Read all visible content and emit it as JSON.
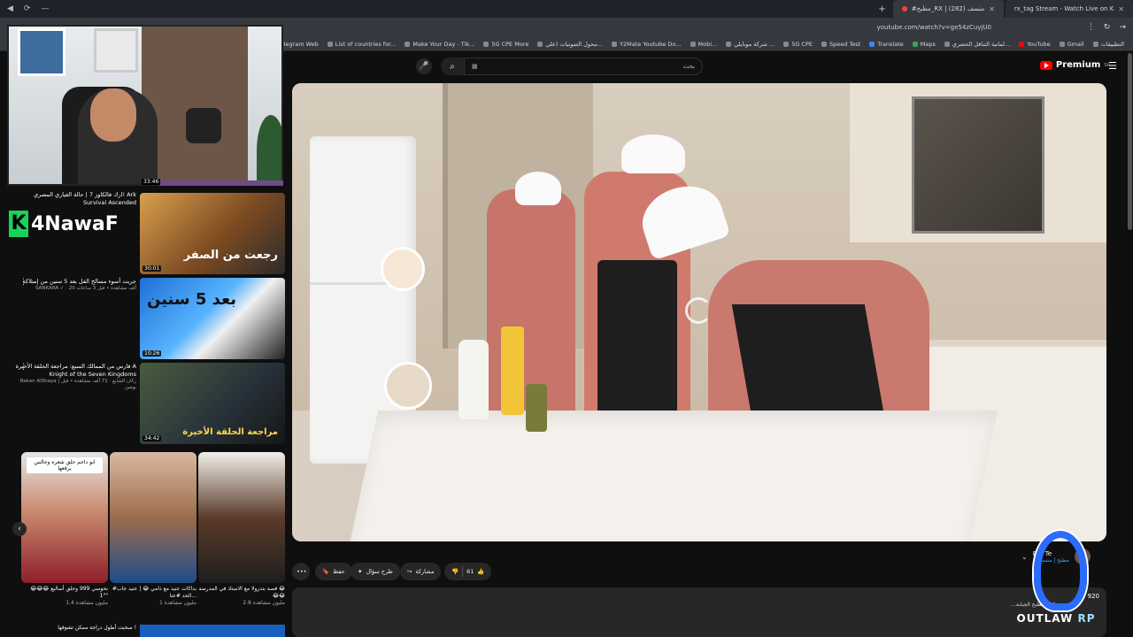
{
  "window_controls": [
    "◀",
    "⟳",
    "—"
  ],
  "tabs": [
    {
      "label": "rx_tag Stream - Watch Live on K",
      "active": false
    },
    {
      "label": "#مطبخ_RX | منسف (282)",
      "active": true
    }
  ],
  "url": "youtube.com/watch?v=ge54zCuyjU0",
  "bookmarks": [
    "التطبيقات",
    "Gmail",
    "YouTube",
    "لمانية التناقل الحضري...",
    "Maps",
    "Translate",
    "Speed Test",
    "5G CPE",
    "شركة موبايلي ...",
    "Mobi...",
    "Y2Mate Youtube Do...",
    "محول الصوتيات (علي...",
    "5G CPE More",
    "Make Your Day - Tik...",
    "List of countries for...",
    "Telegram Web",
    "ouTube"
  ],
  "header": {
    "search_placeholder": "بحث",
    "search_value": "▦",
    "logo_text": "Premium",
    "logo_region": "SA"
  },
  "webcam": {
    "timer": "33:46"
  },
  "brand": {
    "k": "K",
    "name": "4NawaF"
  },
  "recommendations": [
    {
      "title": "ارك فالكاوز 7 | حالة الغياري المصري! Ark Survival Ascended",
      "meta": "",
      "duration": "30:01",
      "thumb_caption": "رجعت من الصفر"
    },
    {
      "title": "جربت أسوء مسالخ الفل بعد 5 سنين من إمتلاكه",
      "meta": "SANKARA ✓ · 20 ألف مشاهدة • قبل 3 ساعات",
      "duration": "10:26",
      "thumb_caption": "بعد 5 سنين"
    },
    {
      "title": "فارس من الممالك السبع: مراجعة الحلقة الأخيرة A Knight of the Seven Kingdoms",
      "meta": "Rakan AlShaya | ركان الشايع · 71 ألف مشاهدة • قبل يومين",
      "duration": "34:42",
      "thumb_caption": "مراجعة الحلقة الأخيرة"
    }
  ],
  "shorts": [
    {
      "caption": "ابو داحم حلق شعره وجالس يرقعها",
      "title": "نحوسي 999 وحلق أساليع 😂😂😂 \"1\"",
      "views": "1.4 مليون مشاهدة"
    },
    {
      "caption": "",
      "title": "#بداكات عنيد مع ذامي 😂 | عنيد جاب الحد #عنا...",
      "views": "1 مليون مشاهدة"
    },
    {
      "caption": "",
      "title": "قصة بتدزولا مع الاستاذ في المدرسه 😂😂😂",
      "views": "2.8 مليون مشاهدة"
    }
  ],
  "bottom_title": "سحبت أطول دراجة ممكن تشوفها !",
  "video": {
    "likes": "61",
    "share_label": "مشاركة",
    "ask_label": "طرح سؤال",
    "save_label": "حفظ",
    "more_label": "•••",
    "channel_name": "RX- Te",
    "channel_subs": "",
    "title_link": "#مطبخ | منسف",
    "views": "920",
    "description": "...كم المطبخ الجبابة"
  },
  "watermark": {
    "text_a": "OUTLAW",
    "text_b": "RP"
  },
  "colors": {
    "youtube_red": "#ff0000",
    "kick_green": "#16d35b",
    "bg": "#0f0f0f"
  }
}
